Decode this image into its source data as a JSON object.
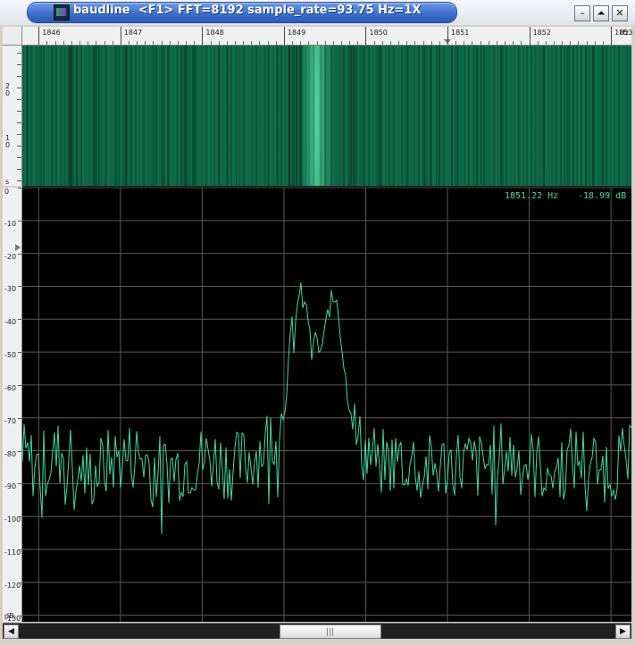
{
  "window": {
    "title": "baudline  <F1> FFT=8192 sample_rate=93.75 Hz=1X",
    "minimize_label": "–",
    "maximize_label": "⏶",
    "close_label": "✕"
  },
  "frequency_ruler": {
    "labels": [
      "1846",
      "1847",
      "1848",
      "1849",
      "1850",
      "1851",
      "1852",
      "1853"
    ],
    "unit": "Hz"
  },
  "time_ruler": {
    "labels": [
      "2\n0",
      "1\n0",
      "s"
    ]
  },
  "db_ruler": {
    "labels": [
      "0",
      "-10",
      "-20",
      "-30",
      "-40",
      "-50",
      "-60",
      "-70",
      "-80",
      "-90",
      "-100",
      "-110",
      "-120",
      "-130"
    ],
    "unit": "dB"
  },
  "cursor_readout": {
    "frequency": "1851.22 Hz",
    "level": "-18.99 dB"
  },
  "scrollbar": {
    "left_arrow": "◀",
    "right_arrow": "▶",
    "position_fraction": 0.44
  },
  "colors": {
    "spectrum_trace": "#3fd9a4",
    "grid": "#5a5a5a",
    "spectrogram": "#0f6a4a",
    "title_bar": "#3f6fcc"
  },
  "chart_data": {
    "type": "line",
    "xlabel": "",
    "ylabel": "",
    "x_unit": "Hz",
    "y_unit": "dB",
    "xlim": [
      1845.8,
      1853.25
    ],
    "ylim": [
      -132,
      0
    ],
    "grid": true,
    "series": [
      {
        "x": [
          1845.8,
          1846.0,
          1846.3,
          1846.6,
          1846.9,
          1847.2,
          1847.5,
          1847.8,
          1848.1,
          1848.4,
          1848.7,
          1848.85,
          1849.0,
          1849.05,
          1849.1,
          1849.2,
          1849.3,
          1849.35,
          1849.45,
          1849.5,
          1849.55,
          1849.65,
          1849.75,
          1849.9,
          1850.2,
          1850.5,
          1850.8,
          1851.1,
          1851.4,
          1851.7,
          1852.0,
          1852.3,
          1852.6,
          1852.9,
          1853.25
        ],
        "values": [
          -82,
          -85,
          -80,
          -88,
          -83,
          -81,
          -86,
          -84,
          -82,
          -85,
          -80,
          -75,
          -68,
          -55,
          -42,
          -32,
          -40,
          -45,
          -50,
          -45,
          -36,
          -33,
          -58,
          -78,
          -84,
          -82,
          -86,
          -83,
          -85,
          -81,
          -84,
          -86,
          -82,
          -85,
          -83
        ]
      }
    ]
  }
}
